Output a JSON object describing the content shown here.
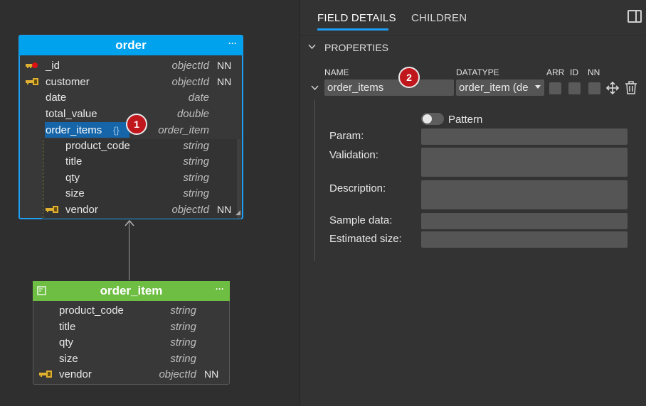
{
  "canvas": {
    "order": {
      "title": "order",
      "menu": "···",
      "fields": [
        {
          "name": "_id",
          "type": "objectId",
          "nn": "NN",
          "icon": "primary-key-icon"
        },
        {
          "name": "customer",
          "type": "objectId",
          "nn": "NN",
          "icon": "foreign-key-icon"
        },
        {
          "name": "date",
          "type": "date",
          "nn": ""
        },
        {
          "name": "total_value",
          "type": "double",
          "nn": ""
        },
        {
          "name": "order_items",
          "type": "order_item",
          "nn": "",
          "braces": "{}"
        }
      ],
      "subfields": [
        {
          "name": "product_code",
          "type": "string"
        },
        {
          "name": "title",
          "type": "string"
        },
        {
          "name": "qty",
          "type": "string"
        },
        {
          "name": "size",
          "type": "string"
        },
        {
          "name": "vendor",
          "type": "objectId",
          "nn": "NN",
          "icon": "foreign-key-icon"
        }
      ]
    },
    "order_item": {
      "title": "order_item",
      "menu": "···",
      "fields": [
        {
          "name": "product_code",
          "type": "string"
        },
        {
          "name": "title",
          "type": "string"
        },
        {
          "name": "qty",
          "type": "string"
        },
        {
          "name": "size",
          "type": "string"
        },
        {
          "name": "vendor",
          "type": "objectId",
          "nn": "NN",
          "icon": "foreign-key-icon"
        }
      ]
    },
    "badge1": "1",
    "badge2": "2"
  },
  "panel": {
    "tabs": [
      "FIELD DETAILS",
      "CHILDREN"
    ],
    "section": "PROPERTIES",
    "columns": {
      "name": "NAME",
      "datatype": "DATATYPE",
      "arr": "ARR",
      "id": "ID",
      "nn": "NN"
    },
    "field": {
      "name": "order_items",
      "datatype": "order_item (de"
    },
    "pattern_label": "Pattern",
    "form": {
      "param": "Param:",
      "validation": "Validation:",
      "description": "Description:",
      "sample": "Sample data:",
      "estimated": "Estimated size:"
    }
  },
  "colors": {
    "order_header": "#00a2ed",
    "order_item_header": "#6fbe44",
    "accent": "#1e9ff2",
    "badge": "#c0171d"
  }
}
